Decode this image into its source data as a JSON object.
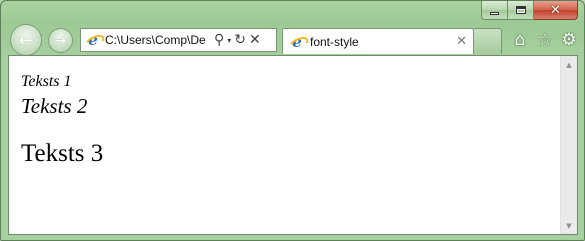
{
  "window": {
    "caption_buttons": {
      "minimize_icon": "minimize-icon",
      "maximize_icon": "maximize-icon",
      "close_icon": "close-icon",
      "close_glyph": "✕"
    }
  },
  "nav": {
    "back_glyph": "←",
    "forward_glyph": "→"
  },
  "address": {
    "value": "C:\\Users\\Comp\\De",
    "search_glyph": "⚲",
    "dropdown_glyph": "▾",
    "refresh_glyph": "↻",
    "stop_glyph": "✕"
  },
  "tabs": [
    {
      "label": "font-style",
      "icon": "ie-icon",
      "close_glyph": "✕",
      "active": true
    }
  ],
  "toolbar": {
    "home_glyph": "⌂",
    "favorites_glyph": "☆",
    "tools_glyph": "⚙"
  },
  "scrollbar": {
    "up_glyph": "▲",
    "down_glyph": "▼"
  },
  "page": {
    "lines": [
      "Teksts 1",
      "Teksts 2",
      "Teksts 3"
    ]
  },
  "colors": {
    "frame": "#9dc994",
    "close_button": "#c1412a",
    "link_blue": "#2b6fc4"
  }
}
